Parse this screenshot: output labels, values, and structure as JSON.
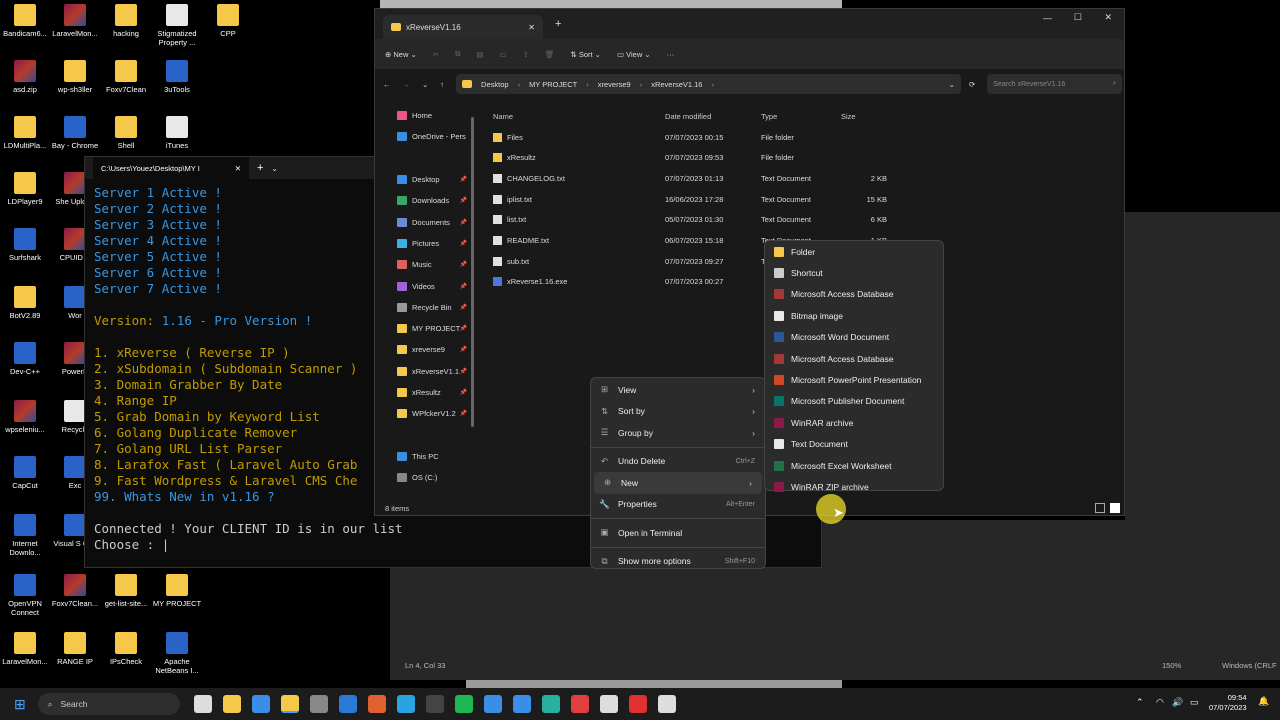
{
  "desktop_icons": [
    {
      "label": "Bandicam6...",
      "kind": "fold",
      "col": 0,
      "row": 0
    },
    {
      "label": "LaravelMon...",
      "kind": "rar",
      "col": 1,
      "row": 0
    },
    {
      "label": "hacking",
      "kind": "fold",
      "col": 2,
      "row": 0
    },
    {
      "label": "Stigmatized Property ...",
      "kind": "bgimg",
      "col": 3,
      "row": 0
    },
    {
      "label": "CPP",
      "kind": "fold",
      "col": 4,
      "row": 0
    },
    {
      "label": "asd.zip",
      "kind": "rar",
      "col": 0,
      "row": 1
    },
    {
      "label": "wp-sh3ller",
      "kind": "fold",
      "col": 1,
      "row": 1
    },
    {
      "label": "Foxv7Clean",
      "kind": "fold",
      "col": 2,
      "row": 1
    },
    {
      "label": "3uTools",
      "kind": "app",
      "col": 3,
      "row": 1
    },
    {
      "label": "LDMultiPla...",
      "kind": "fold",
      "col": 0,
      "row": 2
    },
    {
      "label": "Bay - Chrome",
      "kind": "app",
      "col": 1,
      "row": 2
    },
    {
      "label": "Shell",
      "kind": "fold",
      "col": 2,
      "row": 2
    },
    {
      "label": "iTunes",
      "kind": "bgimg",
      "col": 3,
      "row": 2
    },
    {
      "label": "LDPlayer9",
      "kind": "fold",
      "col": 0,
      "row": 3
    },
    {
      "label": "She Upload",
      "kind": "rar",
      "col": 1,
      "row": 3
    },
    {
      "label": "Surfshark",
      "kind": "app",
      "col": 0,
      "row": 4
    },
    {
      "label": "CPUID C",
      "kind": "rar",
      "col": 1,
      "row": 4
    },
    {
      "label": "BotV2.89",
      "kind": "fold",
      "col": 0,
      "row": 5
    },
    {
      "label": "Wor",
      "kind": "app",
      "col": 1,
      "row": 5
    },
    {
      "label": "Dev-C++",
      "kind": "app",
      "col": 0,
      "row": 6
    },
    {
      "label": "PowerP",
      "kind": "rar",
      "col": 1,
      "row": 6
    },
    {
      "label": "wpseleniu...",
      "kind": "rar",
      "col": 0,
      "row": 7
    },
    {
      "label": "Recycle",
      "kind": "bgimg",
      "col": 1,
      "row": 7
    },
    {
      "label": "CapCut",
      "kind": "app",
      "col": 0,
      "row": 8
    },
    {
      "label": "Exc",
      "kind": "app",
      "col": 1,
      "row": 8
    },
    {
      "label": "Internet Downlo...",
      "kind": "app",
      "col": 0,
      "row": 9
    },
    {
      "label": "Visual S Cod",
      "kind": "app",
      "col": 1,
      "row": 9
    },
    {
      "label": "OpenVPN Connect",
      "kind": "app",
      "col": 0,
      "row": 10
    },
    {
      "label": "Foxv7Clean...",
      "kind": "rar",
      "col": 1,
      "row": 10
    },
    {
      "label": "get-list-site...",
      "kind": "fold",
      "col": 2,
      "row": 10
    },
    {
      "label": "MY PROJECT",
      "kind": "fold",
      "col": 3,
      "row": 10
    },
    {
      "label": "LaravelMon...",
      "kind": "fold",
      "col": 0,
      "row": 11
    },
    {
      "label": "RANGE IP",
      "kind": "fold",
      "col": 1,
      "row": 11
    },
    {
      "label": "IPsCheck",
      "kind": "fold",
      "col": 2,
      "row": 11
    },
    {
      "label": "Apache NetBeans I...",
      "kind": "app",
      "col": 3,
      "row": 11
    }
  ],
  "terminal": {
    "tab_title": "C:\\Users\\Youez\\Desktop\\MY I",
    "servers": [
      "Server 1 Active !",
      "Server 2 Active !",
      "Server 3 Active !",
      "Server 4 Active !",
      "Server 5 Active !",
      "Server 6 Active !",
      "Server 7 Active !"
    ],
    "version_label": "Version:",
    "version_value": "1.16 - Pro Version !",
    "menu": [
      "1. xReverse ( Reverse IP )",
      "2. xSubdomain ( Subdomain Scanner )",
      "3. Domain Grabber By Date",
      "4. Range IP",
      "5. Grab Domain by Keyword List",
      "6. Golang Duplicate Remover",
      "7. Golang URL List Parser",
      "8. Larafox Fast ( Laravel Auto Grab",
      "9. Fast Wordpress & Laravel CMS Che"
    ],
    "whats_new": "99. Whats New in v1.16 ?",
    "connected": "Connected ! Your CLIENT ID is in our list",
    "prompt": "Choose : |"
  },
  "explorer": {
    "tab_title": "xReverseV1.16",
    "toolbar": {
      "new": "New",
      "sort": "Sort",
      "view": "View",
      "more": "···"
    },
    "breadcrumb": [
      "Desktop",
      "MY PROJECT",
      "xreverse9",
      "xReverseV1.16"
    ],
    "search_placeholder": "Search xReverseV1.16",
    "nav": [
      {
        "label": "Home",
        "pin": false
      },
      {
        "label": "OneDrive - Pers",
        "pin": false
      },
      {
        "label": "",
        "pin": false
      },
      {
        "label": "Desktop",
        "pin": true
      },
      {
        "label": "Downloads",
        "pin": true
      },
      {
        "label": "Documents",
        "pin": true
      },
      {
        "label": "Pictures",
        "pin": true
      },
      {
        "label": "Music",
        "pin": true
      },
      {
        "label": "Videos",
        "pin": true
      },
      {
        "label": "Recycle Bin",
        "pin": true
      },
      {
        "label": "MY PROJECT",
        "pin": true
      },
      {
        "label": "xreverse9",
        "pin": true
      },
      {
        "label": "xReverseV1.1",
        "pin": true
      },
      {
        "label": "xResultz",
        "pin": true
      },
      {
        "label": "WPfckerV1.2",
        "pin": true
      },
      {
        "label": "",
        "pin": false
      },
      {
        "label": "This PC",
        "pin": false
      },
      {
        "label": "OS (C:)",
        "pin": false
      }
    ],
    "columns": [
      "Name",
      "Date modified",
      "Type",
      "Size"
    ],
    "files": [
      {
        "name": "Files",
        "date": "07/07/2023 00:15",
        "type": "File folder",
        "size": "",
        "kind": "folder"
      },
      {
        "name": "xResultz",
        "date": "07/07/2023 09:53",
        "type": "File folder",
        "size": "",
        "kind": "folder"
      },
      {
        "name": "CHANGELOG.txt",
        "date": "07/07/2023 01:13",
        "type": "Text Document",
        "size": "2 KB",
        "kind": "txt"
      },
      {
        "name": "iplist.txt",
        "date": "16/06/2023 17:28",
        "type": "Text Document",
        "size": "15 KB",
        "kind": "txt"
      },
      {
        "name": "list.txt",
        "date": "05/07/2023 01:30",
        "type": "Text Document",
        "size": "6 KB",
        "kind": "txt"
      },
      {
        "name": "README.txt",
        "date": "06/07/2023 15:18",
        "type": "Text Document",
        "size": "1 KB",
        "kind": "txt"
      },
      {
        "name": "sub.txt",
        "date": "07/07/2023 09:27",
        "type": "Text Document",
        "size": "",
        "kind": "txt"
      },
      {
        "name": "xReverse1.16.exe",
        "date": "07/07/2023 00:27",
        "type": "",
        "size": "",
        "kind": "exe"
      }
    ],
    "status": "8 items"
  },
  "context_menu": [
    {
      "label": "View",
      "shortcut": "",
      "arrow": true,
      "icon": "⊞"
    },
    {
      "label": "Sort by",
      "shortcut": "",
      "arrow": true,
      "icon": "⇅"
    },
    {
      "label": "Group by",
      "shortcut": "",
      "arrow": true,
      "icon": "☰"
    },
    {
      "sep": true
    },
    {
      "label": "Undo Delete",
      "shortcut": "Ctrl+Z",
      "arrow": false,
      "icon": "↶"
    },
    {
      "label": "New",
      "shortcut": "",
      "arrow": true,
      "icon": "⊕",
      "hl": true
    },
    {
      "label": "Properties",
      "shortcut": "Alt+Enter",
      "arrow": false,
      "icon": "🔧"
    },
    {
      "sep": true
    },
    {
      "label": "Open in Terminal",
      "shortcut": "",
      "arrow": false,
      "icon": "▣"
    },
    {
      "sep": true
    },
    {
      "label": "Show more options",
      "shortcut": "Shift+F10",
      "arrow": false,
      "icon": "⧉"
    }
  ],
  "new_submenu": [
    {
      "label": "Folder",
      "color": "#f5c84a"
    },
    {
      "label": "Shortcut",
      "color": "#cccccc"
    },
    {
      "label": "Microsoft Access Database",
      "color": "#a4373a"
    },
    {
      "label": "Bitmap image",
      "color": "#e8e8e8"
    },
    {
      "label": "Microsoft Word Document",
      "color": "#2b579a"
    },
    {
      "label": "Microsoft Access Database",
      "color": "#a4373a"
    },
    {
      "label": "Microsoft PowerPoint Presentation",
      "color": "#d24726"
    },
    {
      "label": "Microsoft Publisher Document",
      "color": "#077568"
    },
    {
      "label": "WinRAR archive",
      "color": "#8b1a4a"
    },
    {
      "label": "Text Document",
      "color": "#e8e8e8"
    },
    {
      "label": "Microsoft Excel Worksheet",
      "color": "#217346"
    },
    {
      "label": "WinRAR ZIP archive",
      "color": "#8b1a4a"
    }
  ],
  "notepad_status": {
    "pos": "Ln 4, Col 33",
    "zoom": "150%",
    "eol": "Windows (CRLF"
  },
  "taskbar": {
    "search": "Search",
    "time": "09:54",
    "date": "07/07/2023"
  }
}
